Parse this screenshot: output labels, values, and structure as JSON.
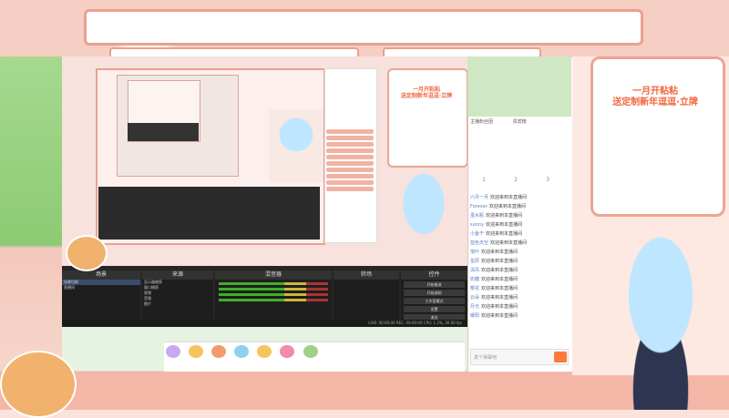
{
  "colors": {
    "frame_pink": "#f6cfc4",
    "frame_border": "#e9a190",
    "promo_orange": "#f2663d",
    "obs_dark": "#262626",
    "chat_user_blue": "#5a7fc4",
    "send_orange": "#ff7a3a"
  },
  "promo": {
    "title": "一月开粘粘",
    "subtitle": "送定制新年逗逗·立牌"
  },
  "obs": {
    "scenes_label": "场景",
    "sources_label": "来源",
    "mixer_label": "混音器",
    "transitions_label": "转场",
    "controls_label": "控件",
    "scenes": [
      "场景切换",
      "直播间"
    ],
    "sources": [
      "显示器捕获",
      "窗口捕获",
      "视频",
      "音频",
      "图片"
    ],
    "controls": [
      "开始推流",
      "开始录制",
      "工作室模式",
      "设置",
      "退出"
    ],
    "status": "LIVE: 00:00:00  REC: 00:00:00  CPU: 1.2%, 30.00 fps"
  },
  "chat": {
    "tab_main": "主播粉丝团",
    "tab_rank": "贵宾榜",
    "ranks": [
      "1",
      "2",
      "3"
    ],
    "messages": [
      {
        "user": "六月一月",
        "text": "欢迎来到本直播间"
      },
      {
        "user": "Forever",
        "text": "欢迎来到本直播间"
      },
      {
        "user": "墨水瓶",
        "text": "欢迎来到本直播间"
      },
      {
        "user": "sunny",
        "text": "欢迎来到本直播间"
      },
      {
        "user": "小鱼干",
        "text": "欢迎来到本直播间"
      },
      {
        "user": "蓝色天空",
        "text": "欢迎来到本直播间"
      },
      {
        "user": "落叶",
        "text": "欢迎来到本直播间"
      },
      {
        "user": "星辰",
        "text": "欢迎来到本直播间"
      },
      {
        "user": "清风",
        "text": "欢迎来到本直播间"
      },
      {
        "user": "奶糖",
        "text": "欢迎来到本直播间"
      },
      {
        "user": "樱花",
        "text": "欢迎来到本直播间"
      },
      {
        "user": "云朵",
        "text": "欢迎来到本直播间"
      },
      {
        "user": "月光",
        "text": "欢迎来到本直播间"
      },
      {
        "user": "暖阳",
        "text": "欢迎来到本直播间"
      }
    ],
    "input_placeholder": "发个弹幕吧"
  },
  "icons": {
    "send": "send-icon",
    "gift": "gift-icon",
    "tiger": "tiger-icon",
    "flower": "flower-icon"
  }
}
